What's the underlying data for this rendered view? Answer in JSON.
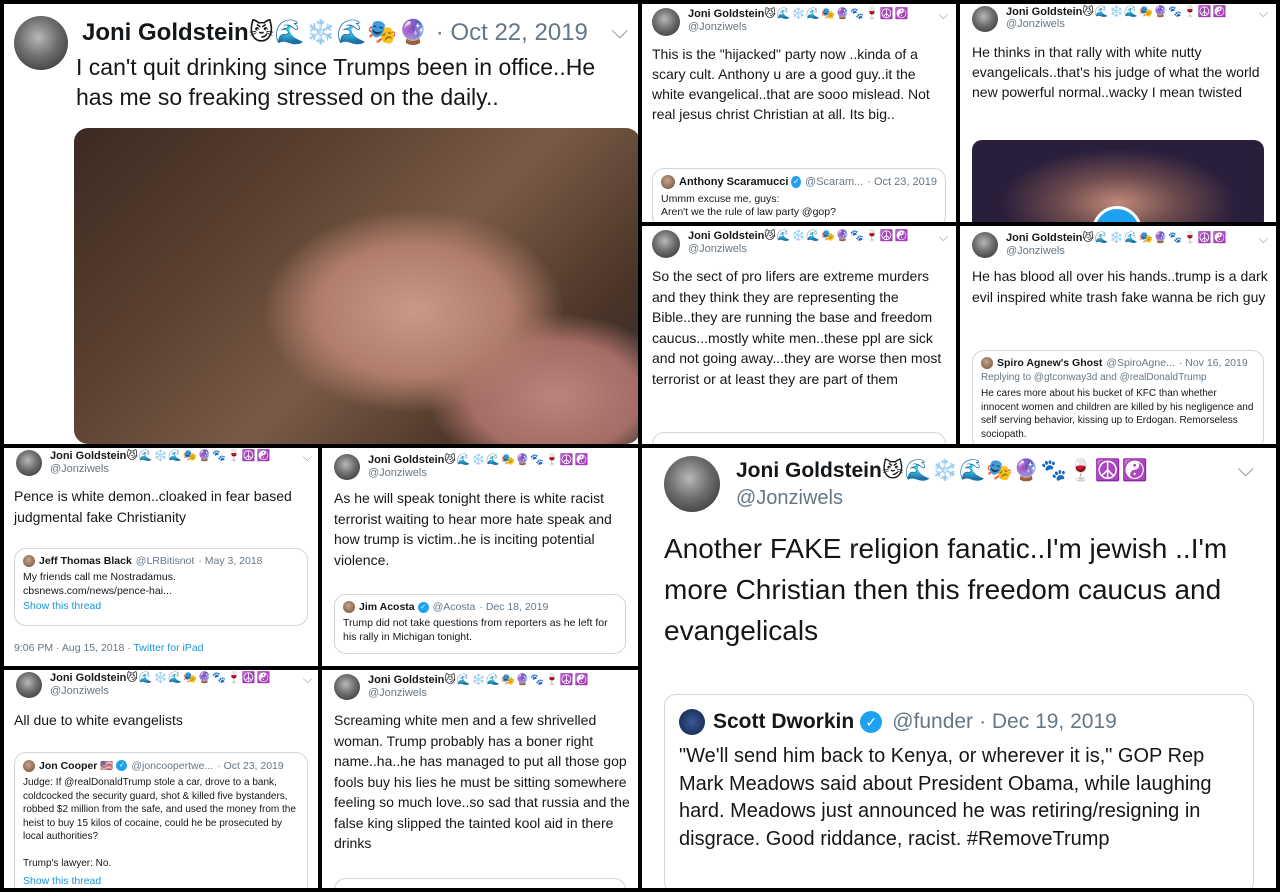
{
  "author": {
    "name": "Joni Goldstein",
    "emojis_full": "😼🌊❄️🌊🎭🔮🐾🍷☮️☯️",
    "emojis_short": "😼🌊❄️🌊🎭🔮",
    "handle": "@Jonziwels"
  },
  "panels": {
    "p1": {
      "date": "· Oct 22, 2019",
      "text": "I can't quit drinking since Trumps been in office..He has me so freaking stressed on the daily.."
    },
    "p2": {
      "text": "This is the \"hijacked\" party now ..kinda of a scary cult. Anthony u are a good guy..it the white evangelical..that are sooo mislead. Not real jesus christ Christian at all. Its big..",
      "quote": {
        "name": "Anthony Scaramucci",
        "handle": "@Scaram...",
        "date": "· Oct 23, 2019",
        "text": "Ummm excuse me, guys:\nAren't we the rule of law party @gop?"
      }
    },
    "p3": {
      "text": "He thinks in that rally with white nutty evangelicals..that's his judge of what the world new powerful normal..wacky I mean twisted"
    },
    "p4": {
      "text": "So the sect of pro lifers are extreme murders and they think they are representing the Bible..they are running the base and freedom caucus...mostly white men..these ppl are sick and not going away...they are worse then most terrorist or at least they are part of them"
    },
    "p5": {
      "text": "He has blood all over his hands..trump is a dark evil inspired white trash fake wanna be rich guy",
      "quote": {
        "name": "Spiro Agnew's Ghost",
        "handle": "@SpiroAgne...",
        "date": "· Nov 16, 2019",
        "replying": "Replying to @gtconway3d and @realDonaldTrump",
        "text": "He cares more about his bucket of KFC than whether innocent women and children are killed by his negligence and self serving behavior, kissing up to Erdogan. Remorseless sociopath."
      }
    },
    "p6": {
      "text": "Pence is white demon..cloaked in fear based judgmental fake Christianity",
      "quote": {
        "name": "Jeff Thomas Black",
        "handle": "@LRBitisnot",
        "date": "· May 3, 2018",
        "text": "My friends call me Nostradamus.\ncbsnews.com/news/pence-hai...",
        "show": "Show this thread"
      },
      "footer_time": "9:06 PM · Aug 15, 2018 · ",
      "footer_app": "Twitter for iPad"
    },
    "p7": {
      "text": "As he will speak tonight there is white racist terrorist waiting to hear more hate speak and how trump is victim..he is inciting potential violence.",
      "quote": {
        "name": "Jim Acosta",
        "handle": "@Acosta",
        "date": "· Dec 18, 2019",
        "text": "Trump did not take questions from reporters as he left for his rally in Michigan tonight."
      }
    },
    "p8": {
      "text": "Another FAKE religion fanatic..I'm jewish ..I'm more Christian then this freedom caucus and evangelicals",
      "quote": {
        "name": "Scott Dworkin",
        "handle": "@funder",
        "date": "· Dec 19, 2019",
        "text": "\"We'll send him back to Kenya, or wherever it is,\" GOP Rep Mark Meadows said about President Obama, while laughing hard. Meadows just announced he was retiring/resigning in disgrace. Good riddance, racist. #RemoveTrump"
      }
    },
    "p9": {
      "text": "All due to white evangelists",
      "quote": {
        "name": "Jon Cooper 🇺🇸",
        "handle": "@joncoopertwe...",
        "date": "· Oct 23, 2019",
        "text": "Judge: If @realDonaldTrump stole a car, drove to a bank, coldcocked the security guard, shot & killed five bystanders, robbed $2 million from the safe, and used the money from the heist to buy 15 kilos of cocaine, could he be prosecuted by local authorities?\n\nTrump's lawyer: No.",
        "show": "Show this thread"
      }
    },
    "p10": {
      "text": "Screaming white men and a few shrivelled woman. Trump probably has a boner right name..ha..he has managed to put all those gop fools buy his lies he must be sitting somewhere feeling so much love..so sad that russia and the false king slipped the tainted kool aid in there drinks"
    }
  },
  "colors": {
    "link": "#1b95e0",
    "muted": "#657786",
    "verified": "#1da1f2",
    "border": "#ccd6dd"
  }
}
